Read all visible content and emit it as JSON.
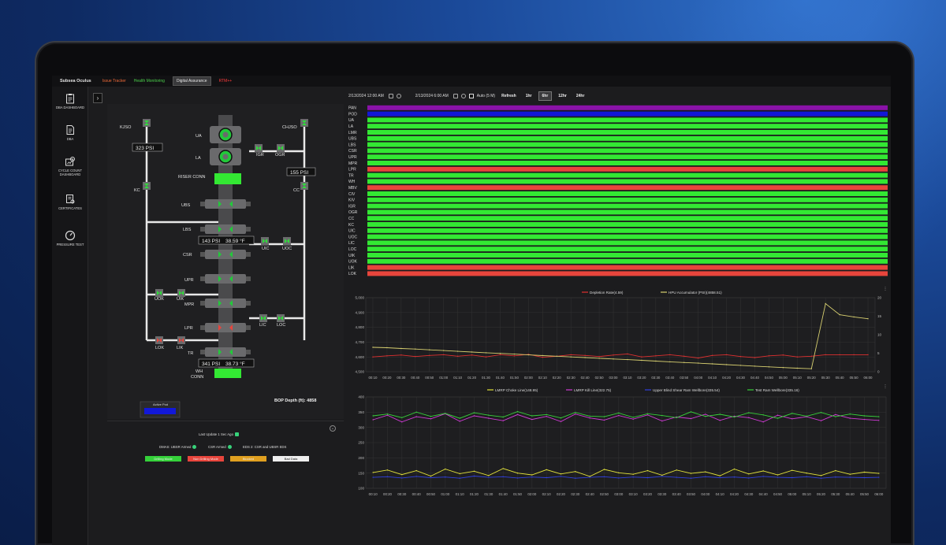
{
  "nav": {
    "brand": "Subsea Oculus",
    "issue_tracker": "Issue Tracker",
    "health_monitoring": "Health Monitoring",
    "digital_assurance": "Digital Assurance",
    "rtm": "RTM++"
  },
  "sidebar": {
    "items": [
      {
        "label": "DBA DASHBOARD",
        "icon": "clipboard-icon"
      },
      {
        "label": "DBA",
        "icon": "document-icon"
      },
      {
        "label": "CYCLE COUNT DASHBOARD",
        "icon": "gear-chart-icon"
      },
      {
        "label": "CERTIFICATES",
        "icon": "certificate-icon"
      },
      {
        "label": "PRESSURE TEST",
        "icon": "gauge-icon"
      }
    ]
  },
  "toolbar": {
    "start_date": "2/13/2024 12:00 AM",
    "end_date": "2/13/2024 6:00 AM",
    "auto_label": "Auto (5 M)",
    "refresh": "Refresh",
    "ranges": [
      "1hr",
      "6hr",
      "12hr",
      "24hr"
    ],
    "active_range": "6hr"
  },
  "diagram": {
    "valves": {
      "kjso": "KJSO",
      "chjso": "CHJSO",
      "kc": "KC",
      "cc": "CC",
      "igr": "IGR",
      "ogr": "OGR",
      "uic": "UIC",
      "uoc": "UOC",
      "uok": "UOK",
      "uik": "UIK",
      "lic": "LIC",
      "loc": "LOC",
      "lok": "LOK",
      "lik": "LIK"
    },
    "components": {
      "ua": "UA",
      "la": "LA",
      "riser_conn": "RISER CONN",
      "ubs": "UBS",
      "lbs": "LBS",
      "csr": "CSR",
      "upr": "UPR",
      "mpr": "MPR",
      "lpr": "LPR",
      "tr": "TR",
      "wh_conn_1": "WH",
      "wh_conn_2": "CONN"
    },
    "readouts": {
      "kill_psi": "323 PSI",
      "choke_psi": "155 PSI",
      "mid_psi": "143 PSI",
      "mid_temp": "38.59 °F",
      "low_psi": "341 PSI",
      "low_temp": "38.73 °F"
    },
    "active_pod_label": "Active Pod",
    "bop_depth": "BOP Depth (ft): 4858"
  },
  "status": {
    "last_update": "Last Update 1 Sec Ago",
    "dmas": "DMAS: UBSR Armed",
    "csr_armed": "CSR Armed",
    "eds": "EDS 2: CSR and UBSR EDS",
    "legend": [
      {
        "label": "Drilling Mode",
        "color": "#35d13a"
      },
      {
        "label": "Non Drilling Mode",
        "color": "#e8453c"
      },
      {
        "label": "Blocked",
        "color": "#e0a020"
      },
      {
        "label": "Bad Data",
        "color": "#eeeeee"
      }
    ]
  },
  "status_chart": {
    "rows": [
      {
        "label": "PAN",
        "state": "purple"
      },
      {
        "label": "POD",
        "state": "blue"
      },
      {
        "label": "UA",
        "state": "green"
      },
      {
        "label": "LA",
        "state": "green"
      },
      {
        "label": "LMR",
        "state": "green"
      },
      {
        "label": "UBS",
        "state": "green"
      },
      {
        "label": "LBS",
        "state": "green"
      },
      {
        "label": "CSR",
        "state": "green"
      },
      {
        "label": "UPR",
        "state": "green"
      },
      {
        "label": "MPR",
        "state": "green"
      },
      {
        "label": "LPR",
        "state": "red"
      },
      {
        "label": "TR",
        "state": "green"
      },
      {
        "label": "WH",
        "state": "green"
      },
      {
        "label": "MBV",
        "state": "red"
      },
      {
        "label": "CIV",
        "state": "green"
      },
      {
        "label": "KIV",
        "state": "green"
      },
      {
        "label": "IGR",
        "state": "green"
      },
      {
        "label": "OGR",
        "state": "green"
      },
      {
        "label": "CC",
        "state": "green"
      },
      {
        "label": "KC",
        "state": "green"
      },
      {
        "label": "UIC",
        "state": "green"
      },
      {
        "label": "UOC",
        "state": "green"
      },
      {
        "label": "LIC",
        "state": "green"
      },
      {
        "label": "LOC",
        "state": "green"
      },
      {
        "label": "UIK",
        "state": "green"
      },
      {
        "label": "UOK",
        "state": "green"
      },
      {
        "label": "LIK",
        "state": "red"
      },
      {
        "label": "LOK",
        "state": "red"
      }
    ],
    "colors": {
      "green": "#33e833",
      "red": "#e8453c",
      "purple": "#8a12a8",
      "blue": "#1218d8"
    }
  },
  "chart_data": [
    {
      "type": "line",
      "legend": [
        "Depletion Rate(4.59)",
        "HPU Accumulator (PSI)(4858.51)"
      ],
      "series_colors": [
        "#e03030",
        "#d8d070"
      ],
      "x": [
        "00:10",
        "00:20",
        "00:30",
        "00:40",
        "00:50",
        "01:00",
        "01:10",
        "01:20",
        "01:30",
        "01:40",
        "01:50",
        "02:00",
        "02:10",
        "02:20",
        "02:30",
        "02:40",
        "02:50",
        "03:00",
        "03:10",
        "03:20",
        "03:30",
        "03:40",
        "03:50",
        "04:00",
        "04:10",
        "04:20",
        "04:30",
        "04:40",
        "04:50",
        "05:00",
        "05:10",
        "05:20",
        "05:30",
        "05:40",
        "05:50",
        "06:00"
      ],
      "ylim_left": [
        4500,
        5000
      ],
      "yticks_left": [
        "5,000",
        "4,900",
        "4,800",
        "4,700",
        "4,600",
        "4,500"
      ],
      "ylim_right": [
        0,
        20
      ],
      "yticks_right": [
        "20",
        "15",
        "10",
        "5",
        "0"
      ],
      "series": [
        {
          "name": "Depletion Rate(4.59)",
          "axis": "right",
          "values": [
            4.0,
            4.3,
            4.5,
            4.1,
            4.4,
            4.6,
            4.2,
            4.5,
            4.0,
            4.6,
            4.3,
            4.7,
            3.9,
            4.2,
            4.6,
            4.4,
            4.1,
            4.5,
            4.8,
            4.0,
            4.3,
            4.6,
            4.2,
            3.7,
            4.4,
            4.6,
            4.1,
            3.8,
            4.3,
            4.5,
            4.0,
            4.2,
            4.6,
            4.6,
            4.6,
            4.6
          ]
        },
        {
          "name": "HPU Accumulator (PSI)(4858.51)",
          "axis": "left",
          "values": [
            4665,
            4662,
            4657,
            4653,
            4648,
            4643,
            4638,
            4633,
            4628,
            4624,
            4619,
            4614,
            4609,
            4605,
            4600,
            4596,
            4591,
            4586,
            4582,
            4577,
            4572,
            4567,
            4562,
            4558,
            4553,
            4548,
            4543,
            4538,
            4533,
            4528,
            4524,
            4520,
            4960,
            4885,
            4870,
            4858
          ]
        }
      ]
    },
    {
      "type": "line",
      "legend": [
        "LMRP Choke Line(148.95)",
        "LMRP Kill Line(322.75)",
        "Upper Blind Shear Ram Wellbore(335.54)",
        "Test Ram Wellbore(335.16)"
      ],
      "series_colors": [
        "#e2e23a",
        "#d13ad6",
        "#3040e0",
        "#37d13a"
      ],
      "x": [
        "00:10",
        "00:20",
        "00:30",
        "00:40",
        "00:50",
        "01:00",
        "01:10",
        "01:20",
        "01:30",
        "01:40",
        "01:50",
        "02:00",
        "02:10",
        "02:20",
        "02:30",
        "02:40",
        "02:50",
        "03:00",
        "03:10",
        "03:20",
        "03:30",
        "03:40",
        "03:50",
        "04:00",
        "04:10",
        "04:20",
        "04:30",
        "04:40",
        "04:50",
        "05:00",
        "05:10",
        "05:20",
        "05:30",
        "05:40",
        "05:50",
        "06:00"
      ],
      "ylim": [
        100,
        400
      ],
      "yticks": [
        "400",
        "350",
        "300",
        "250",
        "200",
        "150",
        "100"
      ],
      "series": [
        {
          "name": "LMRP Choke Line(148.95)",
          "values": [
            152,
            160,
            145,
            158,
            140,
            163,
            148,
            156,
            142,
            165,
            150,
            144,
            161,
            147,
            155,
            139,
            162,
            151,
            146,
            158,
            143,
            160,
            149,
            154,
            141,
            163,
            147,
            157,
            144,
            159,
            150,
            142,
            158,
            146,
            153,
            149
          ]
        },
        {
          "name": "LMRP Kill Line(322.75)",
          "values": [
            325,
            340,
            318,
            335,
            328,
            345,
            320,
            338,
            330,
            322,
            342,
            326,
            336,
            319,
            344,
            331,
            324,
            339,
            327,
            341,
            321,
            334,
            329,
            343,
            323,
            337,
            332,
            318,
            340,
            328,
            335,
            322,
            342,
            330,
            326,
            323
          ]
        },
        {
          "name": "Upper Blind Shear Ram Wellbore(335.54)",
          "values": [
            136,
            138,
            134,
            139,
            135,
            137,
            133,
            140,
            136,
            138,
            134,
            137,
            135,
            139,
            133,
            136,
            138,
            134,
            137,
            135,
            139,
            136,
            133,
            138,
            135,
            137,
            134,
            139,
            136,
            135,
            138,
            133,
            137,
            136,
            135,
            136
          ]
        },
        {
          "name": "Test Ram Wellbore(335.16)",
          "values": [
            338,
            344,
            332,
            350,
            336,
            346,
            330,
            348,
            340,
            334,
            352,
            338,
            342,
            331,
            349,
            337,
            335,
            347,
            333,
            345,
            339,
            332,
            351,
            336,
            343,
            334,
            348,
            341,
            330,
            346,
            337,
            349,
            335,
            344,
            338,
            335
          ]
        }
      ]
    }
  ]
}
